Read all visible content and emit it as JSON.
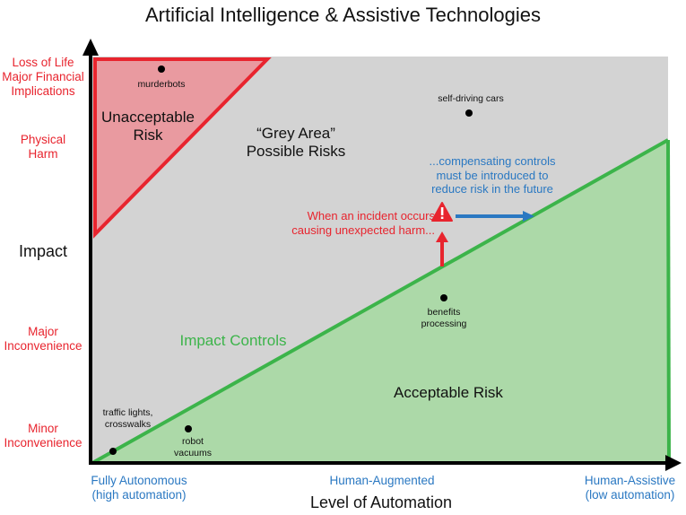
{
  "title": "Artificial Intelligence & Assistive Technologies",
  "axes": {
    "y_label": "Impact",
    "x_label": "Level of Automation",
    "y_levels": [
      "Loss of Life\nMajor Financial\nImplications",
      "Physical\nHarm",
      "Major\nInconvenience",
      "Minor\nInconvenience"
    ],
    "x_levels": [
      "Fully Autonomous\n(high automation)",
      "Human-Augmented",
      "Human-Assistive\n(low automation)"
    ]
  },
  "regions": {
    "unacceptable": "Unacceptable\nRisk",
    "grey": "“Grey Area”\nPossible Risks",
    "acceptable": "Acceptable Risk",
    "impact_controls": "Impact Controls"
  },
  "annotations": {
    "incident": "When an incident occurs\ncausing unexpected harm...",
    "compensating": "...compensating controls\nmust be introduced to\nreduce risk in the future"
  },
  "points": [
    {
      "label": "murderbots"
    },
    {
      "label": "self-driving cars"
    },
    {
      "label": "benefits\nprocessing"
    },
    {
      "label": "traffic lights,\ncrosswalks"
    },
    {
      "label": "robot\nvacuums"
    }
  ],
  "colors": {
    "red": "#e8242e",
    "red_fill": "#e99aa0",
    "grey_fill": "#d3d3d3",
    "green": "#3cb44a",
    "green_fill": "#acd9a8",
    "blue": "#2a78c2",
    "axis": "#000000"
  }
}
